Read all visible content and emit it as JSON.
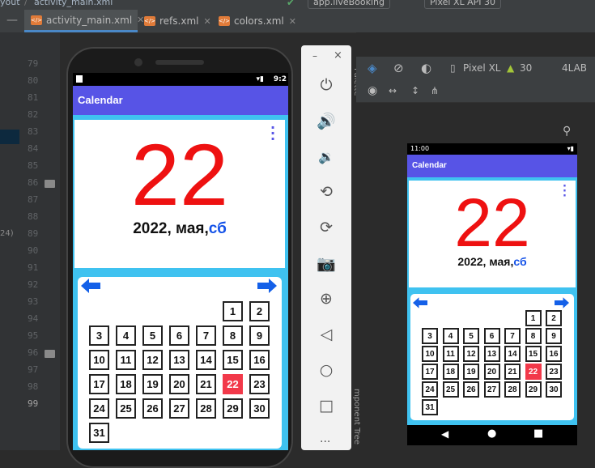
{
  "topbar": {
    "breadcrumb_left": "yout",
    "breadcrumb_file": "activity_main.xml",
    "run_config": "app.liveBooking",
    "device": "Pixel XL API 30"
  },
  "tabs": [
    {
      "label": "activity_main.xml",
      "active": true
    },
    {
      "label": "refs.xml",
      "active": false
    },
    {
      "label": "colors.xml",
      "active": false
    }
  ],
  "editor": {
    "line_numbers": [
      "79",
      "80",
      "81",
      "82",
      "83",
      "84",
      "85",
      "86",
      "87",
      "88",
      "89",
      "90",
      "91",
      "92",
      "93",
      "94",
      "95",
      "96",
      "97",
      "98",
      "99"
    ],
    "left_fragment": "24)"
  },
  "emulator": {
    "status_time": "9:2",
    "app_title": "Calendar",
    "day": "22",
    "date_text": "2022, мая,",
    "weekday": "сб",
    "week1": [
      "",
      "",
      "",
      "",
      "",
      "1",
      "2"
    ],
    "week2": [
      "3",
      "4",
      "5",
      "6",
      "7",
      "8",
      "9"
    ],
    "week3": [
      "10",
      "11",
      "12",
      "13",
      "14",
      "15",
      "16"
    ],
    "week4": [
      "17",
      "18",
      "19",
      "20",
      "21",
      "22",
      "23"
    ],
    "week5": [
      "24",
      "25",
      "26",
      "27",
      "28",
      "29",
      "30"
    ],
    "week6": [
      "31",
      "",
      "",
      "",
      "",
      "",
      ""
    ],
    "today": "22",
    "toolbar": {
      "minimize": "–",
      "close": "×",
      "more": "..."
    }
  },
  "preview_toolbar": {
    "device": "Pixel XL",
    "api": "30",
    "locale": "4LAB"
  },
  "side_labels": {
    "palette": "Palette",
    "component_tree": "mponent Tree"
  },
  "preview": {
    "status_time": "11:00",
    "app_title": "Calendar",
    "day": "22",
    "date_text": "2022, мая,",
    "weekday": "сб"
  },
  "colors": {
    "ide_bg": "#2b2b2b",
    "app_bar": "#5754e6",
    "accent_cyan": "#3fc2f0",
    "day_red": "#ee1111",
    "today_bg": "#f2394a",
    "weekday_blue": "#1452e8"
  }
}
